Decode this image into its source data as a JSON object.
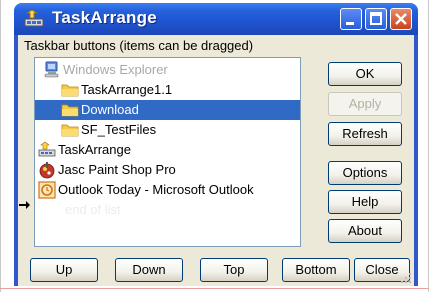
{
  "window": {
    "title": "TaskArrange"
  },
  "group_label": "Taskbar buttons (items can be dragged)",
  "list": {
    "items": [
      {
        "label": "Windows Explorer",
        "icon": "computer-icon",
        "state": "disabled",
        "indent": 0
      },
      {
        "label": "TaskArrange1.1",
        "icon": "folder-icon",
        "state": "normal",
        "indent": 1
      },
      {
        "label": "Download",
        "icon": "folder-icon",
        "state": "selected",
        "indent": 1
      },
      {
        "label": "SF_TestFiles",
        "icon": "folder-icon",
        "state": "normal",
        "indent": 1
      },
      {
        "label": "TaskArrange",
        "icon": "taskarrange-icon",
        "state": "normal",
        "indent": 0
      },
      {
        "label": "Jasc Paint Shop Pro",
        "icon": "paintshop-icon",
        "state": "normal",
        "indent": 0
      },
      {
        "label": "Outlook Today - Microsoft Outlook",
        "icon": "outlook-icon",
        "state": "normal",
        "indent": 0
      },
      {
        "label": "end of list",
        "icon": "",
        "state": "endlist",
        "indent": 0
      }
    ]
  },
  "buttons": {
    "ok": "OK",
    "apply": "Apply",
    "refresh": "Refresh",
    "options": "Options",
    "help": "Help",
    "about": "About",
    "up": "Up",
    "down": "Down",
    "top": "Top",
    "bottom": "Bottom",
    "close": "Close"
  },
  "colors": {
    "titlebar": "#2561db",
    "selection": "#316ac5",
    "dialog_bg": "#ece9d8"
  }
}
